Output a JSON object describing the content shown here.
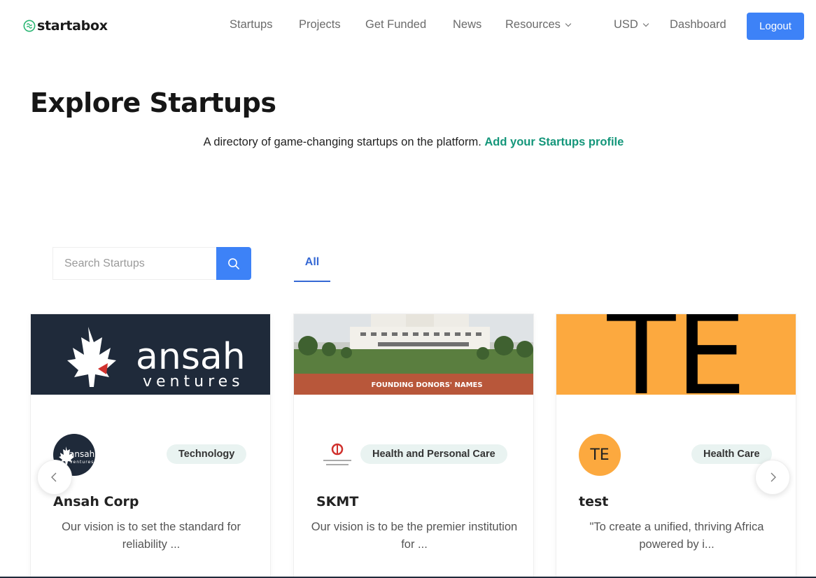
{
  "brand": {
    "name": "startabox",
    "color": "#2bb673"
  },
  "nav": {
    "items": [
      {
        "label": "Startups"
      },
      {
        "label": "Projects"
      },
      {
        "label": "Get Funded"
      },
      {
        "label": "News"
      },
      {
        "label": "Resources",
        "dropdown": true
      },
      {
        "label": "USD",
        "dropdown": true
      },
      {
        "label": "Dashboard"
      }
    ],
    "logout_label": "Logout",
    "accent": "#3d82f7"
  },
  "hero": {
    "title": "Explore Startups",
    "subtitle": "A directory of game-changing startups on the platform.",
    "subtitle_link": "Add your Startups profile"
  },
  "search": {
    "placeholder": "Search Startups"
  },
  "tabs": [
    {
      "label": "All",
      "active": true
    }
  ],
  "cards": [
    {
      "name": "Ansah Corp",
      "tag": "Technology",
      "description": "Our vision is to set the standard for reliability ...",
      "banner_text": [
        "ansah",
        "ventures"
      ],
      "logo_text": [
        "ansah",
        "ventures"
      ]
    },
    {
      "name": "SKMT",
      "tag": "Health and Personal Care",
      "description": "Our vision is to be the premier institution for ...",
      "banner_text": "FOUNDING DONORS' NAMES"
    },
    {
      "name": "test",
      "tag": "Health Care",
      "description": "\"To create a unified, thriving Africa powered by i...",
      "banner_text": "TE",
      "logo_text": "TE",
      "logo_color": "#fca93f"
    }
  ]
}
